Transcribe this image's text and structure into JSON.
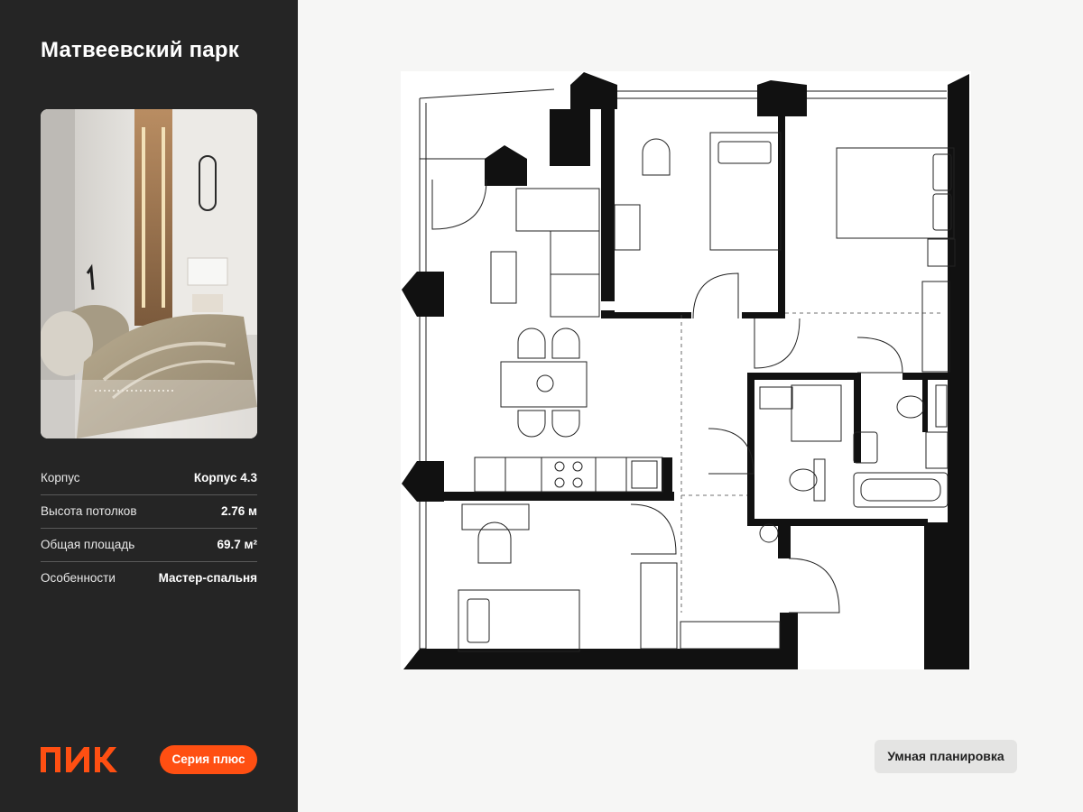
{
  "project": {
    "title": "Матвеевский парк"
  },
  "specs": [
    {
      "label": "Корпус",
      "value": "Корпус 4.3"
    },
    {
      "label": "Высота потолков",
      "value": "2.76 м"
    },
    {
      "label": "Общая площадь",
      "value": "69.7 м²"
    },
    {
      "label": "Особенности",
      "value": "Мастер-спальня"
    }
  ],
  "brand": {
    "logo_text": "ПИК",
    "logo_color": "#ff4f12"
  },
  "series_badge": {
    "label": "Серия плюс",
    "color": "#ff4f12"
  },
  "smart_layout_button": {
    "label": "Умная планировка"
  },
  "colors": {
    "sidebar": "#252525",
    "background": "#f6f6f5",
    "accent": "#ff4f12"
  }
}
